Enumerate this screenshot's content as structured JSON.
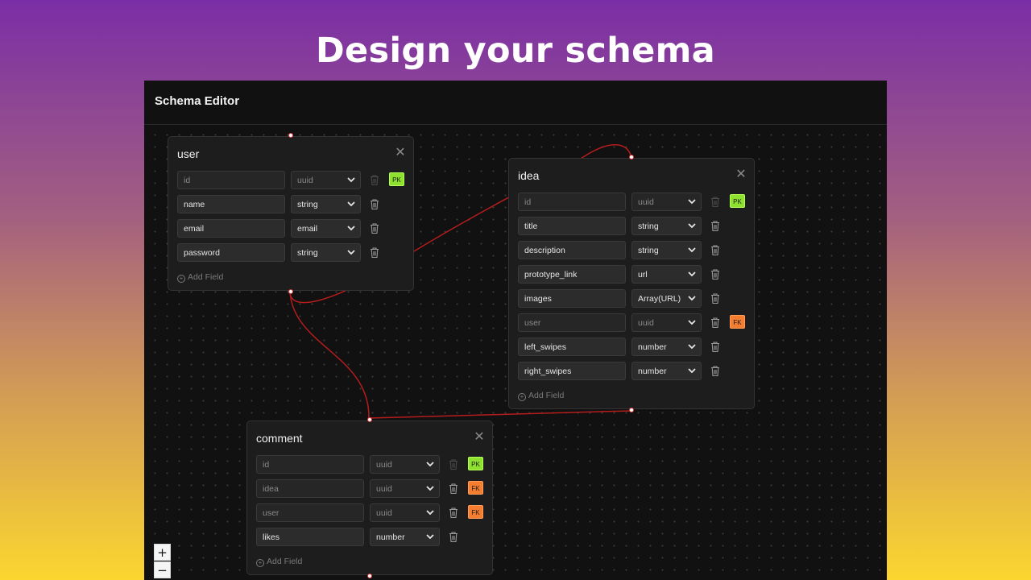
{
  "headline": "Design your schema",
  "app": {
    "title": "Schema Editor"
  },
  "colors": {
    "edge": "#b51d1d",
    "pk": "#8fe12f",
    "fk": "#f47d2f"
  },
  "tables": {
    "user": {
      "name": "user",
      "fields": [
        {
          "name": "id",
          "type": "uuid",
          "key": "PK"
        },
        {
          "name": "name",
          "type": "string",
          "key": ""
        },
        {
          "name": "email",
          "type": "email",
          "key": ""
        },
        {
          "name": "password",
          "type": "string",
          "key": ""
        }
      ],
      "add_label": "Add Field"
    },
    "idea": {
      "name": "idea",
      "fields": [
        {
          "name": "id",
          "type": "uuid",
          "key": "PK"
        },
        {
          "name": "title",
          "type": "string",
          "key": ""
        },
        {
          "name": "description",
          "type": "string",
          "key": ""
        },
        {
          "name": "prototype_link",
          "type": "url",
          "key": ""
        },
        {
          "name": "images",
          "type": "Array(URL)",
          "key": ""
        },
        {
          "name": "user",
          "type": "uuid",
          "key": "FK"
        },
        {
          "name": "left_swipes",
          "type": "number",
          "key": ""
        },
        {
          "name": "right_swipes",
          "type": "number",
          "key": ""
        }
      ],
      "add_label": "Add Field"
    },
    "comment": {
      "name": "comment",
      "fields": [
        {
          "name": "id",
          "type": "uuid",
          "key": "PK"
        },
        {
          "name": "idea",
          "type": "uuid",
          "key": "FK"
        },
        {
          "name": "user",
          "type": "uuid",
          "key": "FK"
        },
        {
          "name": "likes",
          "type": "number",
          "key": ""
        }
      ],
      "add_label": "Add Field"
    }
  },
  "zoom": {
    "in_label": "+",
    "out_label": "−"
  }
}
